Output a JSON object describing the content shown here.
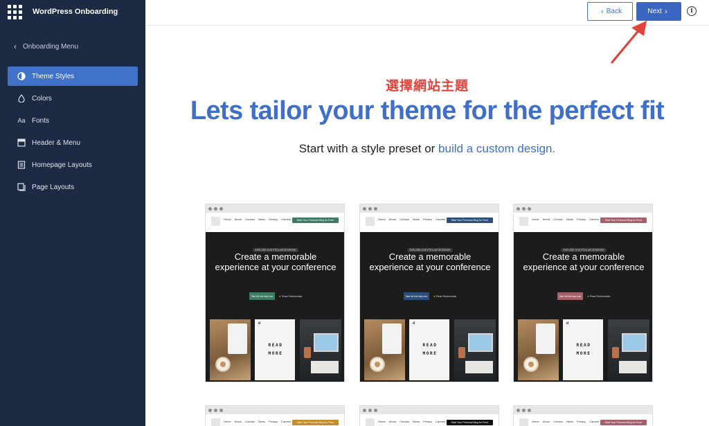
{
  "app": {
    "title": "WordPress Onboarding"
  },
  "sidebar": {
    "back_label": "Onboarding Menu",
    "items": [
      {
        "label": "Theme Styles",
        "icon": "contrast-icon",
        "active": true
      },
      {
        "label": "Colors",
        "icon": "droplet-icon"
      },
      {
        "label": "Fonts",
        "icon": "typography-icon"
      },
      {
        "label": "Header & Menu",
        "icon": "layout-header-icon"
      },
      {
        "label": "Homepage Layouts",
        "icon": "document-icon"
      },
      {
        "label": "Page Layouts",
        "icon": "pages-icon"
      }
    ]
  },
  "toolbar": {
    "back_label": "Back",
    "next_label": "Next",
    "info_label": "i"
  },
  "main": {
    "annotation": "選擇網站主題",
    "headline": "Lets tailor your theme for the perfect fit",
    "subline_prefix": "Start with a style preset or ",
    "subline_link": "build a custom design."
  },
  "preview": {
    "nav": [
      "Home",
      "About",
      "Contact",
      "News",
      "Privacy",
      "Careers"
    ],
    "cta": "Start Your Personal Blog for Free!",
    "eyebrow": "EXPLORE OUR STELLAR SESSIONS",
    "heading": "Create a memorable experience at your conference",
    "hero_button": "Take the first step now",
    "testimonials": "Read Testimonials",
    "tiles": "READ MORE",
    "tile_mark": "d"
  },
  "presets": [
    {
      "accent": "#3f7a63",
      "font": "sans"
    },
    {
      "accent": "#2b4f7a",
      "font": "condensed"
    },
    {
      "accent": "#a4616a",
      "font": "serif"
    }
  ],
  "presets_row2": [
    {
      "accent": "#c48c2c"
    },
    {
      "accent": "#111111"
    },
    {
      "accent": "#a4616a"
    }
  ]
}
